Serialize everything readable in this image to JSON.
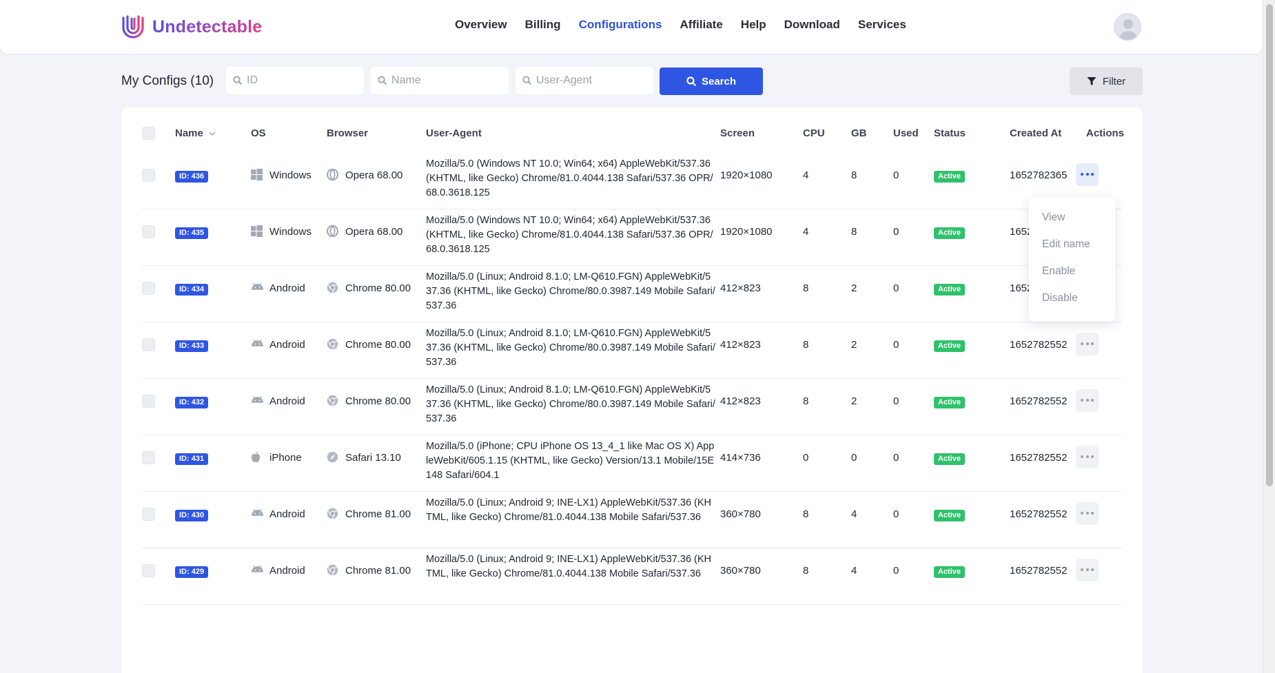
{
  "app": {
    "name": "Undetectable"
  },
  "nav": {
    "items": [
      "Overview",
      "Billing",
      "Configurations",
      "Affiliate",
      "Help",
      "Download",
      "Services"
    ],
    "active": "Configurations"
  },
  "toolbar": {
    "title": "My Configs (10)",
    "id_placeholder": "ID",
    "name_placeholder": "Name",
    "ua_placeholder": "User-Agent",
    "search_label": "Search",
    "filter_label": "Filter"
  },
  "table": {
    "headers": {
      "name": "Name",
      "os": "OS",
      "browser": "Browser",
      "ua": "User-Agent",
      "screen": "Screen",
      "cpu": "CPU",
      "gb": "GB",
      "used": "Used",
      "status": "Status",
      "created": "Created At",
      "actions": "Actions"
    },
    "rows": [
      {
        "id": "ID: 436",
        "os": "Windows",
        "os_icon": "windows-icon",
        "browser": "Opera 68.00",
        "browser_icon": "opera-icon",
        "ua": "Mozilla/5.0 (Windows NT 10.0; Win64; x64) AppleWebKit/537.36 (KHTML, like Gecko) Chrome/81.0.4044.138 Safari/537.36 OPR/68.0.3618.125",
        "screen": "1920×1080",
        "cpu": "4",
        "gb": "8",
        "used": "0",
        "status": "Active",
        "created": "1652782365"
      },
      {
        "id": "ID: 435",
        "os": "Windows",
        "os_icon": "windows-icon",
        "browser": "Opera 68.00",
        "browser_icon": "opera-icon",
        "ua": "Mozilla/5.0 (Windows NT 10.0; Win64; x64) AppleWebKit/537.36 (KHTML, like Gecko) Chrome/81.0.4044.138 Safari/537.36 OPR/68.0.3618.125",
        "screen": "1920×1080",
        "cpu": "4",
        "gb": "8",
        "used": "0",
        "status": "Active",
        "created": "1652"
      },
      {
        "id": "ID: 434",
        "os": "Android",
        "os_icon": "android-icon",
        "browser": "Chrome 80.00",
        "browser_icon": "chrome-icon",
        "ua": "Mozilla/5.0 (Linux; Android 8.1.0; LM-Q610.FGN) AppleWebKit/537.36 (KHTML, like Gecko) Chrome/80.0.3987.149 Mobile Safari/537.36",
        "screen": "412×823",
        "cpu": "8",
        "gb": "2",
        "used": "0",
        "status": "Active",
        "created": "1652"
      },
      {
        "id": "ID: 433",
        "os": "Android",
        "os_icon": "android-icon",
        "browser": "Chrome 80.00",
        "browser_icon": "chrome-icon",
        "ua": "Mozilla/5.0 (Linux; Android 8.1.0; LM-Q610.FGN) AppleWebKit/537.36 (KHTML, like Gecko) Chrome/80.0.3987.149 Mobile Safari/537.36",
        "screen": "412×823",
        "cpu": "8",
        "gb": "2",
        "used": "0",
        "status": "Active",
        "created": "1652782552"
      },
      {
        "id": "ID: 432",
        "os": "Android",
        "os_icon": "android-icon",
        "browser": "Chrome 80.00",
        "browser_icon": "chrome-icon",
        "ua": "Mozilla/5.0 (Linux; Android 8.1.0; LM-Q610.FGN) AppleWebKit/537.36 (KHTML, like Gecko) Chrome/80.0.3987.149 Mobile Safari/537.36",
        "screen": "412×823",
        "cpu": "8",
        "gb": "2",
        "used": "0",
        "status": "Active",
        "created": "1652782552"
      },
      {
        "id": "ID: 431",
        "os": "iPhone",
        "os_icon": "apple-icon",
        "browser": "Safari 13.10",
        "browser_icon": "safari-icon",
        "ua": "Mozilla/5.0 (iPhone; CPU iPhone OS 13_4_1 like Mac OS X) AppleWebKit/605.1.15 (KHTML, like Gecko) Version/13.1 Mobile/15E148 Safari/604.1",
        "screen": "414×736",
        "cpu": "0",
        "gb": "0",
        "used": "0",
        "status": "Active",
        "created": "1652782552"
      },
      {
        "id": "ID: 430",
        "os": "Android",
        "os_icon": "android-icon",
        "browser": "Chrome 81.00",
        "browser_icon": "chrome-icon",
        "ua": "Mozilla/5.0 (Linux; Android 9; INE-LX1) AppleWebKit/537.36 (KHTML, like Gecko) Chrome/81.0.4044.138 Mobile Safari/537.36",
        "screen": "360×780",
        "cpu": "8",
        "gb": "4",
        "used": "0",
        "status": "Active",
        "created": "1652782552"
      },
      {
        "id": "ID: 429",
        "os": "Android",
        "os_icon": "android-icon",
        "browser": "Chrome 81.00",
        "browser_icon": "chrome-icon",
        "ua": "Mozilla/5.0 (Linux; Android 9; INE-LX1) AppleWebKit/537.36 (KHTML, like Gecko) Chrome/81.0.4044.138 Mobile Safari/537.36",
        "screen": "360×780",
        "cpu": "8",
        "gb": "4",
        "used": "0",
        "status": "Active",
        "created": "1652782552"
      }
    ]
  },
  "dropdown": {
    "items": [
      "View",
      "Edit name",
      "Enable",
      "Disable"
    ]
  },
  "colors": {
    "brand_start": "#5b4ee6",
    "brand_end": "#d9408a",
    "accent": "#2f56e2",
    "active_status": "#2fc16b"
  }
}
